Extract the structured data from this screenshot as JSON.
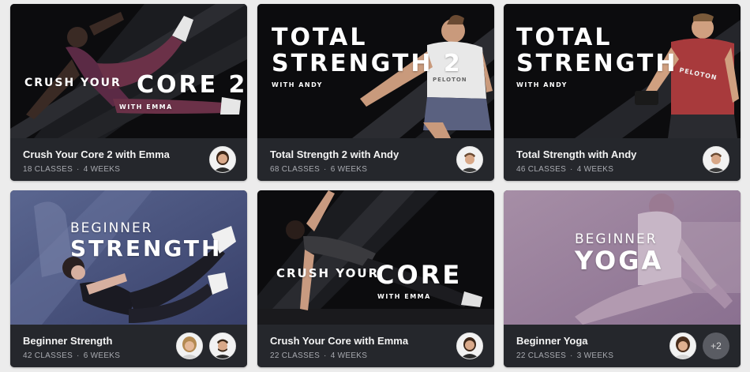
{
  "cards": [
    {
      "title": "Crush Your Core 2 with Emma",
      "classes": "18 CLASSES",
      "weeks": "4 WEEKS",
      "banner": {
        "line1": "CRUSH YOUR",
        "line2": "CORE 2",
        "instructor": "WITH EMMA"
      },
      "instructors": [
        "instructor-emma"
      ]
    },
    {
      "title": "Total Strength 2 with Andy",
      "classes": "68 CLASSES",
      "weeks": "6 WEEKS",
      "banner": {
        "line1": "TOTAL",
        "line2": "STRENGTH 2",
        "instructor": "WITH ANDY",
        "shirt": "PELOTON"
      },
      "instructors": [
        "instructor-andy"
      ]
    },
    {
      "title": "Total Strength with Andy",
      "classes": "46 CLASSES",
      "weeks": "4 WEEKS",
      "banner": {
        "line1": "TOTAL",
        "line2": "STRENGTH",
        "instructor": "WITH ANDY",
        "shirt": "PELOTON"
      },
      "instructors": [
        "instructor-andy"
      ]
    },
    {
      "title": "Beginner Strength",
      "classes": "42 CLASSES",
      "weeks": "6 WEEKS",
      "banner": {
        "line1": "BEGINNER",
        "line2": "STRENGTH"
      },
      "instructors": [
        "instructor-female",
        "instructor-male"
      ]
    },
    {
      "title": "Crush Your Core with Emma",
      "classes": "22 CLASSES",
      "weeks": "4 WEEKS",
      "banner": {
        "line1": "CRUSH YOUR",
        "line2": "CORE",
        "instructor": "WITH EMMA"
      },
      "instructors": [
        "instructor-emma"
      ]
    },
    {
      "title": "Beginner Yoga",
      "classes": "22 CLASSES",
      "weeks": "3 WEEKS",
      "banner": {
        "line1": "BEGINNER",
        "line2": "YOGA"
      },
      "instructors": [
        "instructor-female"
      ],
      "more_instructors": "+2"
    }
  ],
  "separator": "·",
  "colors": {
    "card_info_bg": "#25272c",
    "card_title": "#f3f3f3",
    "card_meta": "#a8aab0",
    "page_bg": "#ececec"
  }
}
